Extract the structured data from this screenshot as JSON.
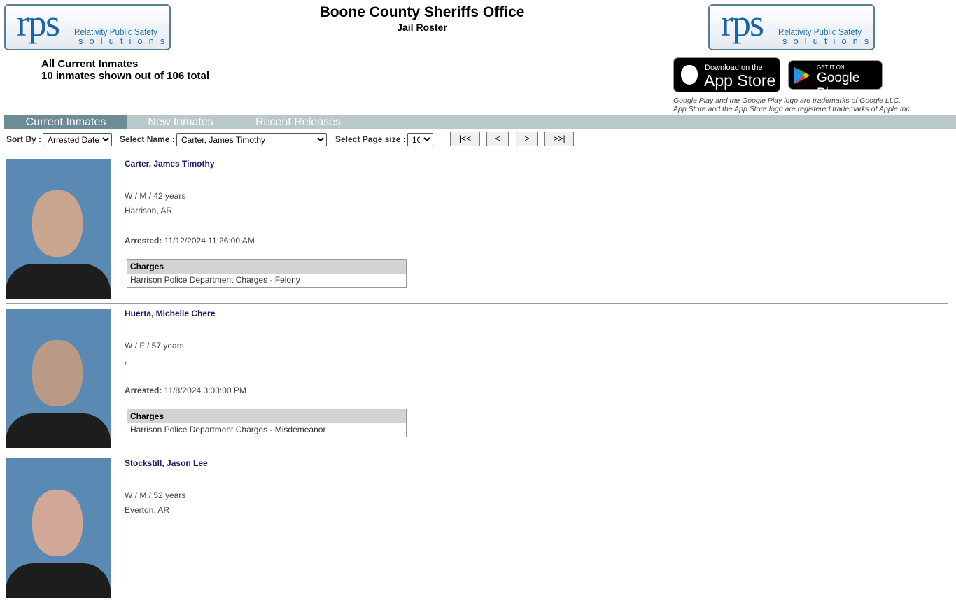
{
  "logo": {
    "big": "rps",
    "line1": "Relativity Public Safety",
    "line2": "solutions"
  },
  "header": {
    "title": "Boone County Sheriffs Office",
    "subtitle": "Jail Roster"
  },
  "summary": {
    "heading": "All Current Inmates",
    "count": "10 inmates shown out of 106 total"
  },
  "badges": {
    "apple_small": "Download on the",
    "apple_big": "App Store",
    "google_small": "GET IT ON",
    "google_big": "Google Play"
  },
  "trademarks": [
    "Google Play and the Google Play logo are trademarks of Google LLC.",
    "App Store and the App Store logo are registered trademarks of Apple Inc."
  ],
  "tabs": [
    "Current Inmates",
    "New Inmates",
    "Recent Releases"
  ],
  "controls": {
    "sort_label": "Sort By :",
    "sort_value": "Arrested Date",
    "name_label": "Select Name :",
    "name_value": "Carter, James Timothy",
    "size_label": "Select Page size :",
    "size_value": "10",
    "first": "|<<",
    "prev": "<",
    "next": ">",
    "last": ">>|"
  },
  "colors": {
    "tab_bar": "#b8c8cb",
    "tab_active": "#6e8c95",
    "name": "#1a1a6e"
  },
  "inmates": [
    {
      "name": "Carter, James Timothy",
      "demo": "W / M / 42 years",
      "city": "Harrison, AR",
      "arrested_label": "Arrested:",
      "arrested": "11/12/2024 11:26:00 AM",
      "charges_header": "Charges",
      "charge": "Harrison Police Department Charges - Felony"
    },
    {
      "name": "Huerta, Michelle Chere",
      "demo": "W / F / 57 years",
      "city": ",",
      "arrested_label": "Arrested:",
      "arrested": "11/8/2024 3:03:00 PM",
      "charges_header": "Charges",
      "charge": "Harrison Police Department Charges - Misdemeanor"
    },
    {
      "name": "Stockstill, Jason Lee",
      "demo": "W / M / 52 years",
      "city": "Everton, AR"
    }
  ]
}
